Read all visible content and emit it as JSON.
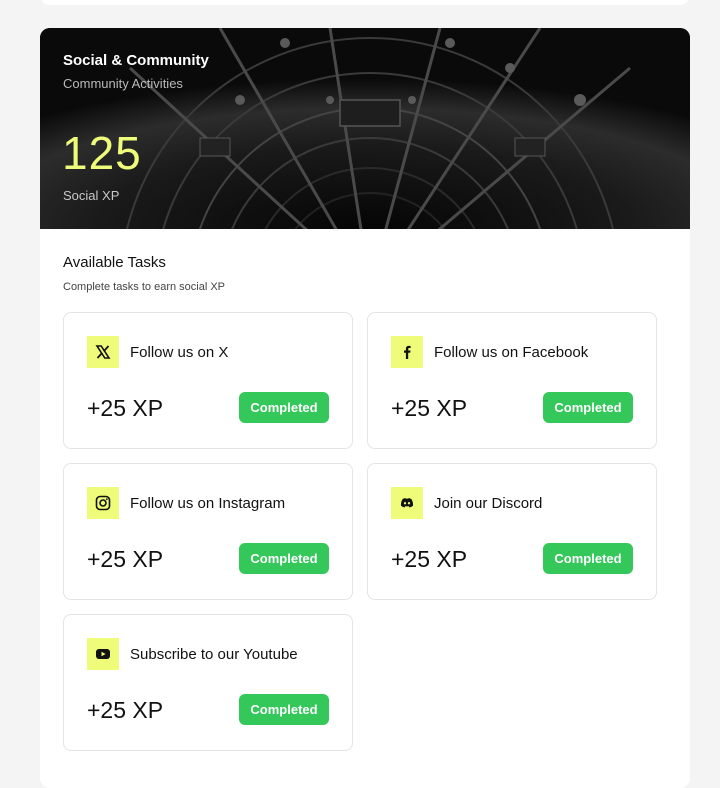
{
  "hero": {
    "title": "Social & Community",
    "subtitle": "Community Activities",
    "xp_value": "125",
    "xp_label": "Social XP",
    "accent_color": "#eefc7a"
  },
  "section": {
    "title": "Available Tasks",
    "subtitle": "Complete tasks to earn social XP"
  },
  "tasks": [
    {
      "name": "Follow us on X",
      "icon": "x-logo-icon",
      "xp": "+25 XP",
      "status": "Completed"
    },
    {
      "name": "Follow us on Facebook",
      "icon": "facebook-icon",
      "xp": "+25 XP",
      "status": "Completed"
    },
    {
      "name": "Follow us on Instagram",
      "icon": "instagram-icon",
      "xp": "+25 XP",
      "status": "Completed"
    },
    {
      "name": "Join our Discord",
      "icon": "discord-icon",
      "xp": "+25 XP",
      "status": "Completed"
    },
    {
      "name": "Subscribe to our Youtube",
      "icon": "youtube-icon",
      "xp": "+25 XP",
      "status": "Completed"
    }
  ],
  "colors": {
    "completed_badge": "#34c759",
    "icon_background": "#eefc7a"
  }
}
